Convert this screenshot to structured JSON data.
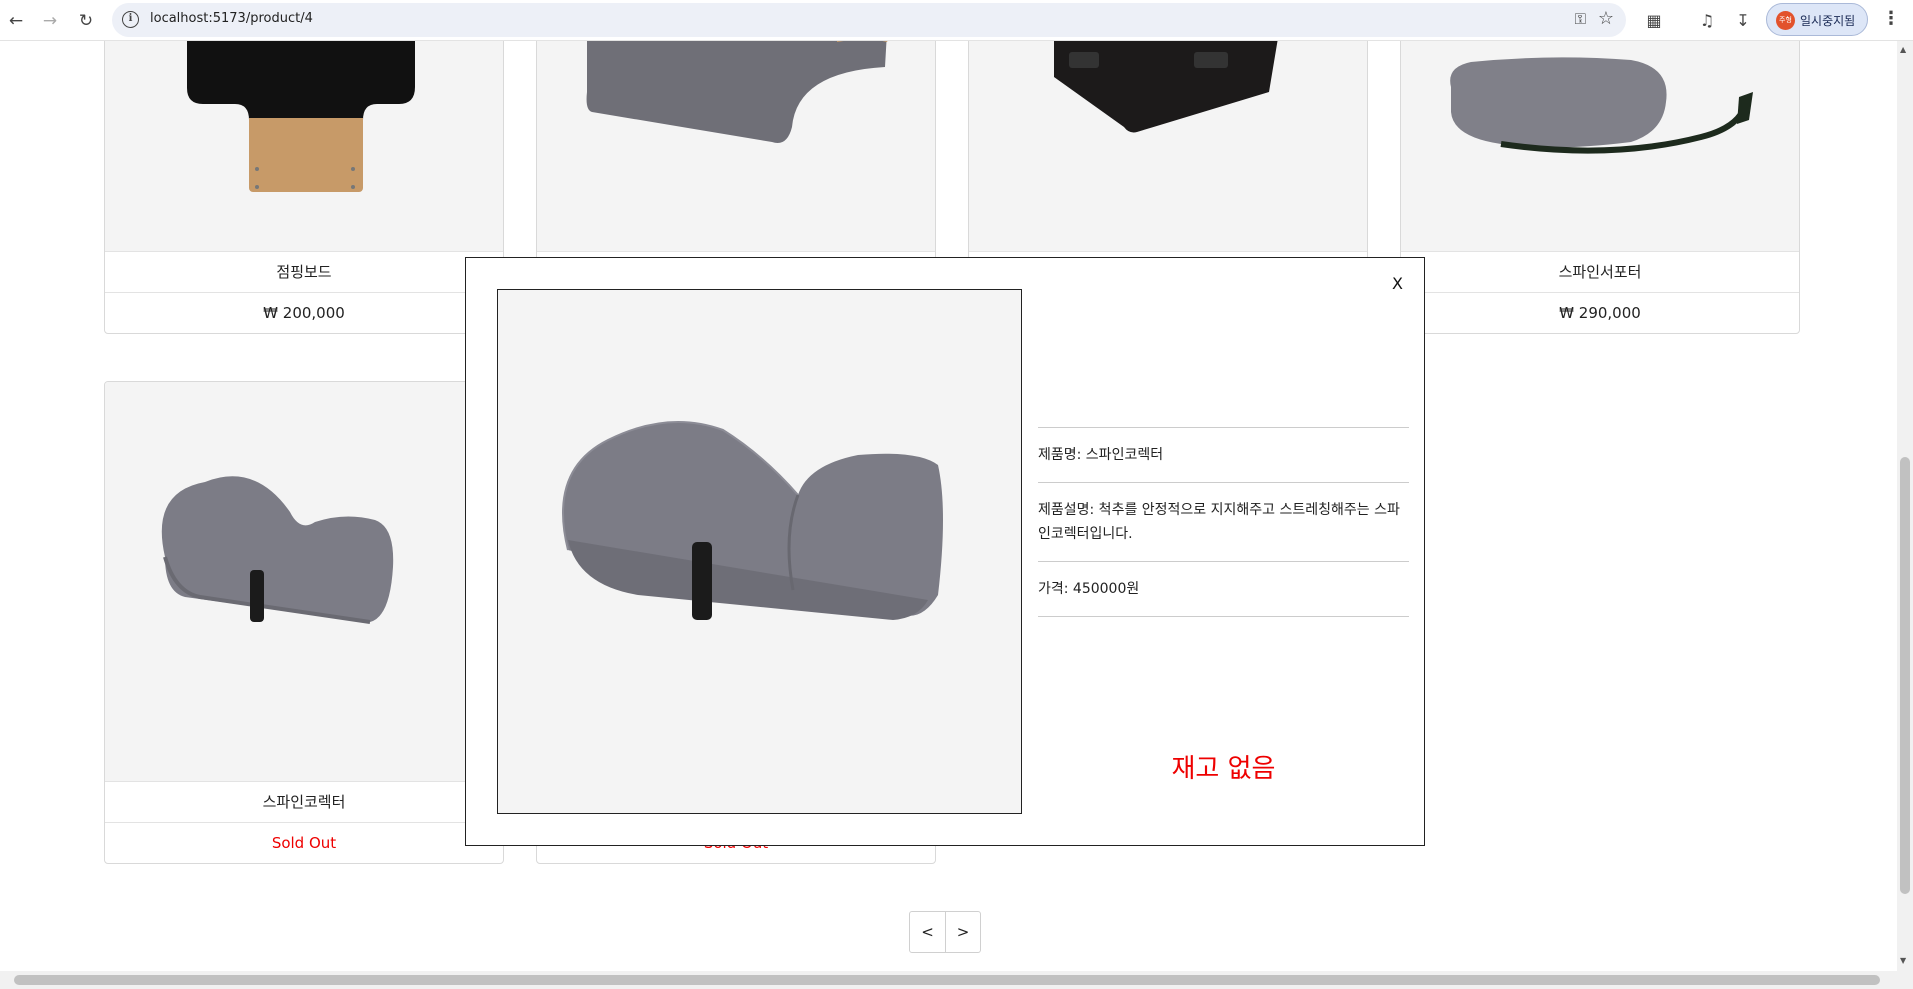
{
  "browser": {
    "url": "localhost:5173/product/4",
    "profile_avatar": "주형",
    "profile_label": "일시중지됨"
  },
  "products_top": [
    {
      "name": "점핑보드",
      "price": "₩ 200,000"
    },
    {
      "name": "",
      "price": ""
    },
    {
      "name": "",
      "price": ""
    },
    {
      "name": "스파인서포터",
      "price": "₩ 290,000"
    }
  ],
  "products_bottom": [
    {
      "name": "스파인코렉터",
      "price": "Sold Out"
    },
    {
      "name": "",
      "price": "Sold Out"
    }
  ],
  "pagination": {
    "prev": "<",
    "next": ">"
  },
  "modal": {
    "close_label": "X",
    "name": "제품명: 스파인코렉터",
    "description": "제품설명: 척추를 안정적으로 지지해주고 스트레칭해주는 스파인코렉터입니다.",
    "price": "가격: 450000원",
    "stock_status": "재고 없음"
  },
  "colors": {
    "sold_out": "#ee0000",
    "product_gray": "#7d7d86"
  },
  "icons": [
    "back-icon",
    "forward-icon",
    "reload-icon",
    "site-info-icon",
    "key-icon",
    "star-icon",
    "extensions-icon",
    "media-icon",
    "download-icon",
    "menu-icon"
  ]
}
